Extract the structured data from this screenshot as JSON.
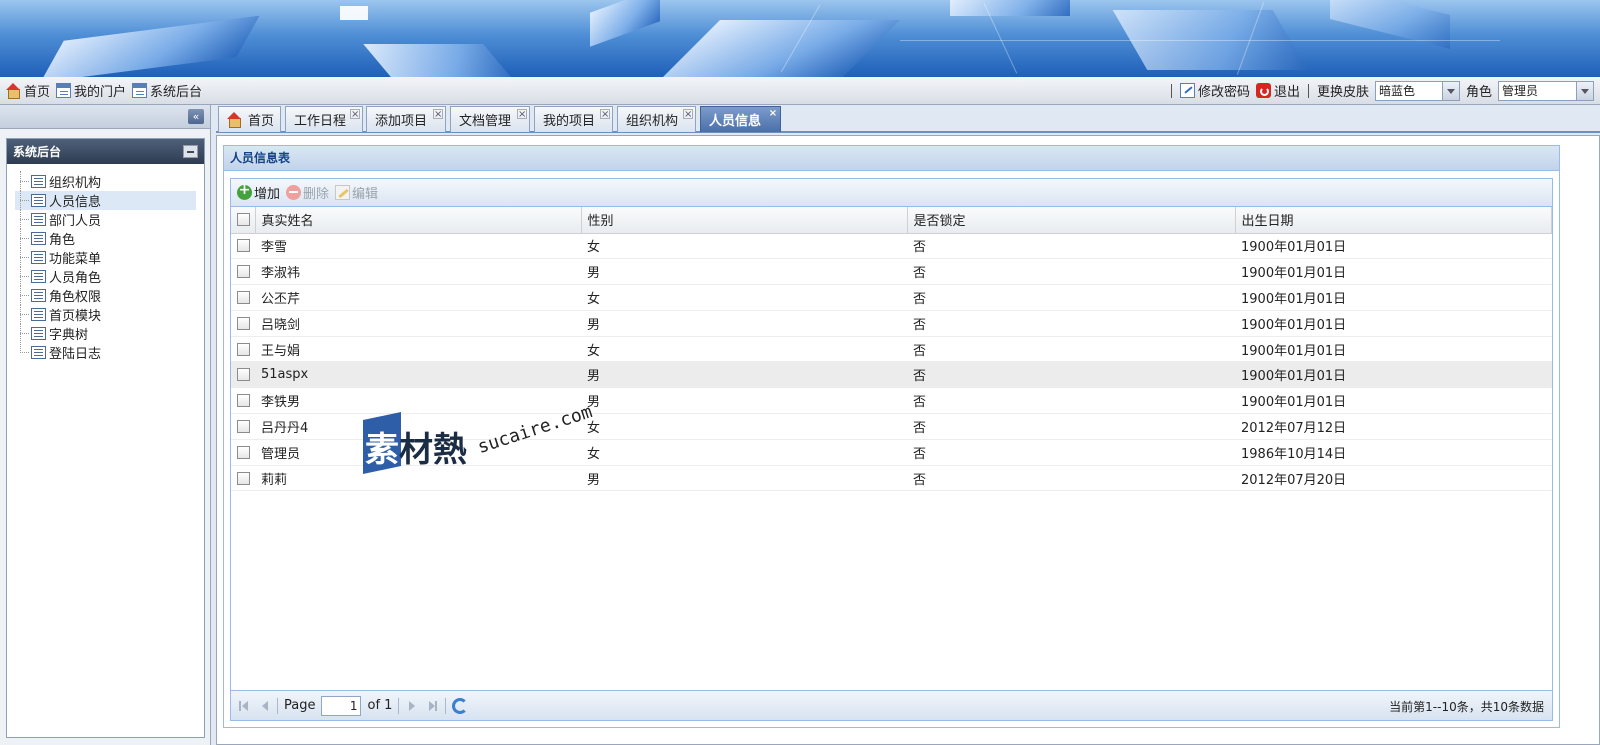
{
  "topnav": {
    "left": [
      {
        "label": "首页",
        "icon": "home-icon"
      },
      {
        "label": "我的门户",
        "icon": "window-icon"
      },
      {
        "label": "系统后台",
        "icon": "window-icon"
      }
    ],
    "change_password": "修改密码",
    "logout": "退出",
    "skin_label": "更换皮肤",
    "skin_value": "暗蓝色",
    "role_label": "角色",
    "role_value": "管理员"
  },
  "sidebar": {
    "title": "系统后台",
    "items": [
      "组织机构",
      "人员信息",
      "部门人员",
      "角色",
      "功能菜单",
      "人员角色",
      "角色权限",
      "首页模块",
      "字典树",
      "登陆日志"
    ],
    "active_index": 1
  },
  "tabs": [
    {
      "label": "首页",
      "closable": false
    },
    {
      "label": "工作日程",
      "closable": true
    },
    {
      "label": "添加项目",
      "closable": true
    },
    {
      "label": "文档管理",
      "closable": true
    },
    {
      "label": "我的项目",
      "closable": true
    },
    {
      "label": "组织机构",
      "closable": true
    },
    {
      "label": "人员信息",
      "closable": true,
      "active": true
    }
  ],
  "grid": {
    "title": "人员信息表",
    "toolbar": {
      "add": "增加",
      "delete": "删除",
      "edit": "编辑"
    },
    "columns": [
      "真实姓名",
      "性别",
      "是否锁定",
      "出生日期"
    ],
    "rows": [
      [
        "李雪",
        "女",
        "否",
        "1900年01月01日"
      ],
      [
        "李淑祎",
        "男",
        "否",
        "1900年01月01日"
      ],
      [
        "公丕芹",
        "女",
        "否",
        "1900年01月01日"
      ],
      [
        "吕晓剑",
        "男",
        "否",
        "1900年01月01日"
      ],
      [
        "王与娟",
        "女",
        "否",
        "1900年01月01日"
      ],
      [
        "51aspx",
        "男",
        "否",
        "1900年01月01日"
      ],
      [
        "李铁男",
        "男",
        "否",
        "1900年01月01日"
      ],
      [
        "吕丹丹4",
        "女",
        "否",
        "2012年07月12日"
      ],
      [
        "管理员",
        "女",
        "否",
        "1986年10月14日"
      ],
      [
        "莉莉",
        "男",
        "否",
        "2012年07月20日"
      ]
    ],
    "highlight_row": 5,
    "pager": {
      "page_label": "Page",
      "page_value": "1",
      "of_label": "of 1",
      "info": "当前第1--10条，共10条数据"
    }
  },
  "watermark": {
    "cn": "素材熱",
    "en": "sucaire.com"
  },
  "colors": {
    "accent": "#4a6fa8",
    "panel_border": "#99bbe8",
    "title_text": "#15428b"
  }
}
